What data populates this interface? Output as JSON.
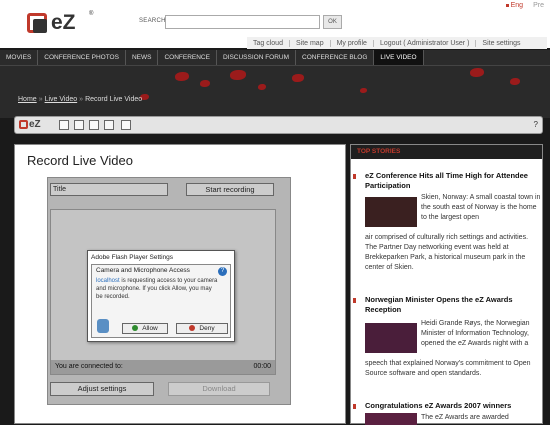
{
  "header": {
    "logo_text": "eZ",
    "logo_reg": "®",
    "search_label": "SEARCH:",
    "search_value": "",
    "search_button": "OK",
    "lang_en": "Eng",
    "lang_pr": "Pre"
  },
  "utility": [
    "Tag cloud",
    "Site map",
    "My profile",
    "Logout ( Administrator User )",
    "Site settings"
  ],
  "nav": [
    "MOVIES",
    "CONFERENCE PHOTOS",
    "NEWS",
    "CONFERENCE",
    "DISCUSSION FORUM",
    "CONFERENCE BLOG",
    "LIVE VIDEO"
  ],
  "breadcrumb": [
    "Home",
    "Live Video",
    "Record Live Video"
  ],
  "toolbar": {
    "logo": "eZ",
    "help": "?"
  },
  "main": {
    "title": "Record Live Video",
    "title_input": "Title",
    "start_button": "Start recording",
    "status_text": "You are connected to:",
    "status_time": "00:00",
    "adjust_button": "Adjust settings",
    "download_button": "Download"
  },
  "flash": {
    "title": "Adobe Flash Player Settings",
    "heading": "Camera and Microphone Access",
    "host": "localhost",
    "message": " is requesting access to your camera and microphone. If you click Allow, you may be recorded.",
    "allow": "Allow",
    "deny": "Deny",
    "help": "?"
  },
  "sidebar": {
    "heading": "TOP STORIES",
    "stories": [
      {
        "title": "eZ Conference Hits all Time High for Attendee Participation",
        "body_right": "Skien, Norway: A small coastal town in the south east of Norway is the home to the largest open",
        "body_full": "air comprised of culturally rich settings and activities. The Partner Day networking event was held at Brekkeparken Park, a historical museum park in the center of Skien."
      },
      {
        "title": "Norwegian Minister Opens the eZ Awards Reception",
        "body_right": "Heidi Grande Røys, the Norwegian Minister of Information Technology, opened the eZ Awards night with a",
        "body_full": "speech that explained Norway's commitment to Open Source software and open standards."
      },
      {
        "title": "Congratulations eZ Awards 2007 winners",
        "body_right": "The eZ Awards are awarded"
      }
    ]
  }
}
